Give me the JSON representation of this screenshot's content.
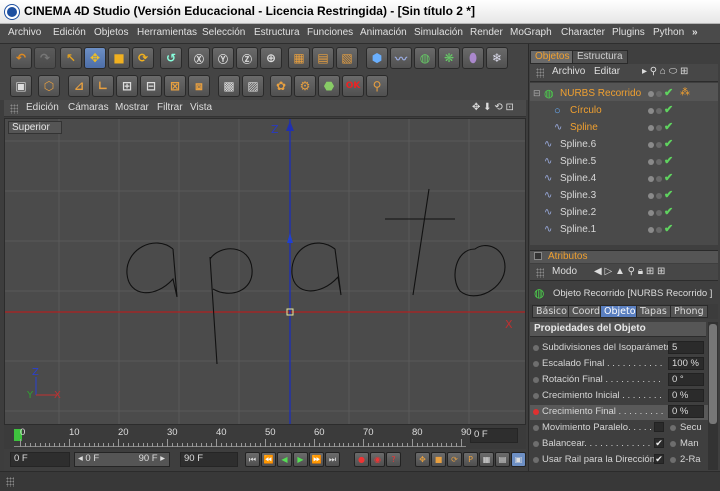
{
  "window": {
    "title": "CINEMA 4D Studio (Versión Educacional - Licencia Restringida) - [Sin título 2 *]"
  },
  "menubar": {
    "items": [
      "Archivo",
      "Edición",
      "Objetos",
      "Herramientas",
      "Selección",
      "Estructura",
      "Funciones",
      "Animación",
      "Simulación",
      "Render",
      "MoGraph",
      "Character",
      "Plugins",
      "Python"
    ],
    "overflow_icon": "chevron-right-icon"
  },
  "viewport": {
    "menu": [
      "Edición",
      "Cámaras",
      "Mostrar",
      "Filtrar",
      "Vista"
    ],
    "view_label": "Superior",
    "axis_z_label": "Z",
    "axis_x_label": "X",
    "gizmo_z": "Z",
    "gizmo_x": "X",
    "colors": {
      "background": "#4b4b4b",
      "grid": "#5a5a5a",
      "axis_x": "#b02020",
      "axis_z": "#2030b0",
      "spline": "#111111"
    }
  },
  "timeline": {
    "ticks": [
      "0",
      "10",
      "20",
      "30",
      "40",
      "50",
      "60",
      "70",
      "80",
      "90"
    ],
    "current_frame": "0 F",
    "cursor_frame": 0
  },
  "controls": {
    "start_field": "0 F",
    "range_start": "0 F",
    "range_end": "90 F",
    "end_field": "90 F"
  },
  "objects_panel": {
    "tabs": [
      "Objetos",
      "Estructura"
    ],
    "menu": [
      "Archivo",
      "Editar"
    ],
    "items": [
      {
        "label": "NURBS Recorrido",
        "color": "#e8a020",
        "indent": 0
      },
      {
        "label": "Círculo",
        "color": "#e8a020",
        "indent": 1
      },
      {
        "label": "Spline",
        "color": "#e8a020",
        "indent": 1
      },
      {
        "label": "Spline.6",
        "color": "#d8d8d8",
        "indent": 0
      },
      {
        "label": "Spline.5",
        "color": "#d8d8d8",
        "indent": 0
      },
      {
        "label": "Spline.4",
        "color": "#d8d8d8",
        "indent": 0
      },
      {
        "label": "Spline.3",
        "color": "#d8d8d8",
        "indent": 0
      },
      {
        "label": "Spline.2",
        "color": "#d8d8d8",
        "indent": 0
      },
      {
        "label": "Spline.1",
        "color": "#d8d8d8",
        "indent": 0
      }
    ]
  },
  "attributes_panel": {
    "tab": "Atributos",
    "mode_label": "Modo",
    "object_title": "Objeto Recorrido [NURBS Recorrido ]",
    "subtabs": [
      "Básico",
      "Coord.",
      "Objeto",
      "Tapas",
      "Phong"
    ],
    "active_subtab": "Objeto",
    "section_title": "Propiedades del Objeto",
    "rows": [
      {
        "label": "Subdivisiones del Isoparámetro",
        "value": "5"
      },
      {
        "label": "Escalado Final . . . . . . . . . . .",
        "value": "100 %"
      },
      {
        "label": "Rotación Final . . . . . . . . . . .",
        "value": "0 °"
      },
      {
        "label": "Crecimiento Inicial . . . . . . . .",
        "value": "0 %"
      },
      {
        "label": "Crecimiento Final . . . . . . . . .",
        "value": "0 %",
        "highlight": true
      }
    ],
    "check_rows": [
      {
        "label": "Movimiento Paralelo. . . . . .",
        "right": "Secu"
      },
      {
        "label": "Balancear. . . . . . . . . . . . .",
        "right": "Man"
      },
      {
        "label": "Usar Rail para la Dirección",
        "right": "2-Ra"
      }
    ]
  }
}
